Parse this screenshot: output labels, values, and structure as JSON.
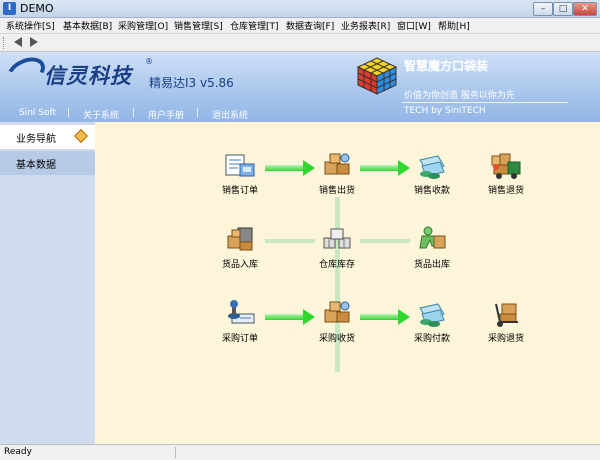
{
  "window": {
    "title": "DEMO",
    "icon_letter": "I",
    "minimize_glyph": "–",
    "maximize_glyph": "□",
    "close_glyph": "✕"
  },
  "menu": [
    {
      "label": "系统操作[S]"
    },
    {
      "label": "基本数据[B]"
    },
    {
      "label": "采购管理[O]"
    },
    {
      "label": "销售管理[S]"
    },
    {
      "label": "仓库管理[T]"
    },
    {
      "label": "数据查询[F]"
    },
    {
      "label": "业务报表[R]"
    },
    {
      "label": "窗口[W]"
    },
    {
      "label": "帮助[H]"
    }
  ],
  "toolbar": {
    "back_glyph": "◆",
    "forward_glyph": "◆"
  },
  "banner": {
    "logo_text": "信灵科技",
    "logo_reg": "®",
    "version": "精易达I3  v5.86",
    "slogan_title": "智慧魔方口袋装",
    "slogan_line": "价值为你创造  服务以你为先",
    "slogan_sub": "TECH by SiniTECH",
    "links": [
      "Sinl Soft",
      "|",
      "关于系统",
      "|",
      "用户手册",
      "|",
      "退出系统"
    ]
  },
  "sidebar": {
    "active_label": "业务导航",
    "items": [
      {
        "label": "基本数据"
      }
    ]
  },
  "flow": {
    "nodes": {
      "sales_order": "销售订单",
      "sales_out": "销售出货",
      "sales_receipt": "销售收款",
      "sales_return": "销售退货",
      "goods_in": "货品入库",
      "stock": "仓库库存",
      "goods_out": "货品出库",
      "purchase_order": "采购订单",
      "purchase_receive": "采购收货",
      "purchase_pay": "采购付款",
      "purchase_return": "采购退货"
    }
  },
  "status": {
    "text": "Ready"
  },
  "colors": {
    "accent_green": "#2fd82f",
    "banner_blue": "#a8c5ec",
    "content_bg": "#fcf5d9"
  }
}
